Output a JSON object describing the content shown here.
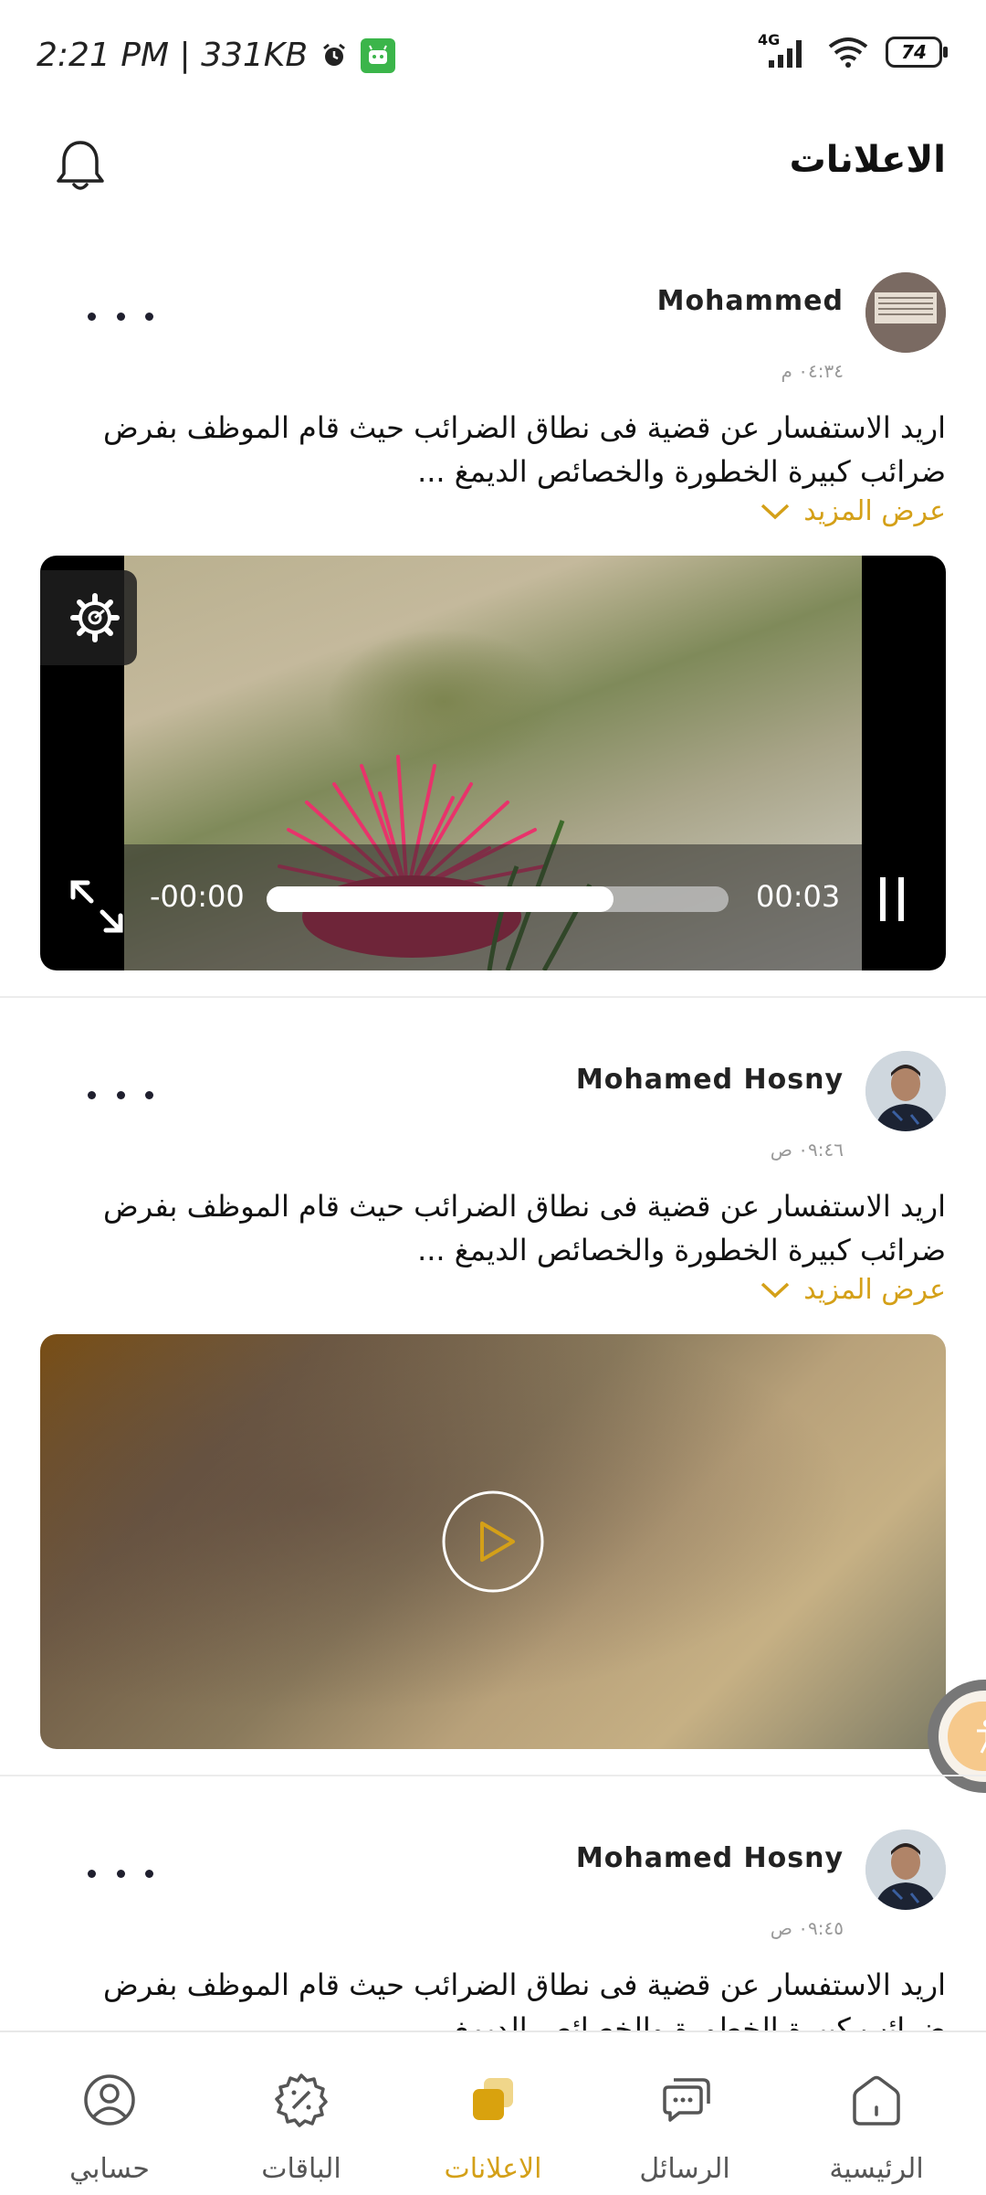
{
  "status_bar": {
    "time_text": "2:21 PM | 331KB",
    "network": "4G",
    "battery": "74"
  },
  "header": {
    "title": "الاعلانات"
  },
  "posts": [
    {
      "author": "Mohammed",
      "time": "٠٤:٣٤ م",
      "text_line1": "اريد الاستفسار عن قضية فى نطاق الضرائب حيث قام الموظف بفرض",
      "text_line2": "ضرائب كبيرة  الخطورة والخصائص الديمغ ...",
      "show_more": "عرض المزيد",
      "video": {
        "state": "playing",
        "elapsed": "00:03",
        "remaining": "-00:00",
        "progress_fraction": 0.75
      }
    },
    {
      "author": "Mohamed Hosny",
      "time": "٠٩:٤٦ ص",
      "text_line1": "اريد الاستفسار عن قضية فى نطاق الضرائب حيث قام الموظف بفرض",
      "text_line2": "ضرائب كبيرة  الخطورة والخصائص الديمغ ...",
      "show_more": "عرض المزيد",
      "video": {
        "state": "paused"
      }
    },
    {
      "author": "Mohamed Hosny",
      "time": "٠٩:٤٥ ص",
      "text_line1": "اريد الاستفسار عن قضية فى نطاق الضرائب حيث قام الموظف بفرض",
      "text_line2": "ضرائب كبيرة  الخطورة والخصائص الديمغ ..."
    }
  ],
  "bottom_nav": {
    "items": [
      {
        "label": "الرئيسية",
        "icon": "home-icon"
      },
      {
        "label": "الرسائل",
        "icon": "chat-icon"
      },
      {
        "label": "الاعلانات",
        "icon": "ads-icon",
        "active": true
      },
      {
        "label": "الباقات",
        "icon": "discount-icon"
      },
      {
        "label": "حسابي",
        "icon": "account-icon"
      }
    ]
  },
  "colors": {
    "accent": "#d4a018",
    "text": "#111111",
    "muted": "#999999"
  }
}
